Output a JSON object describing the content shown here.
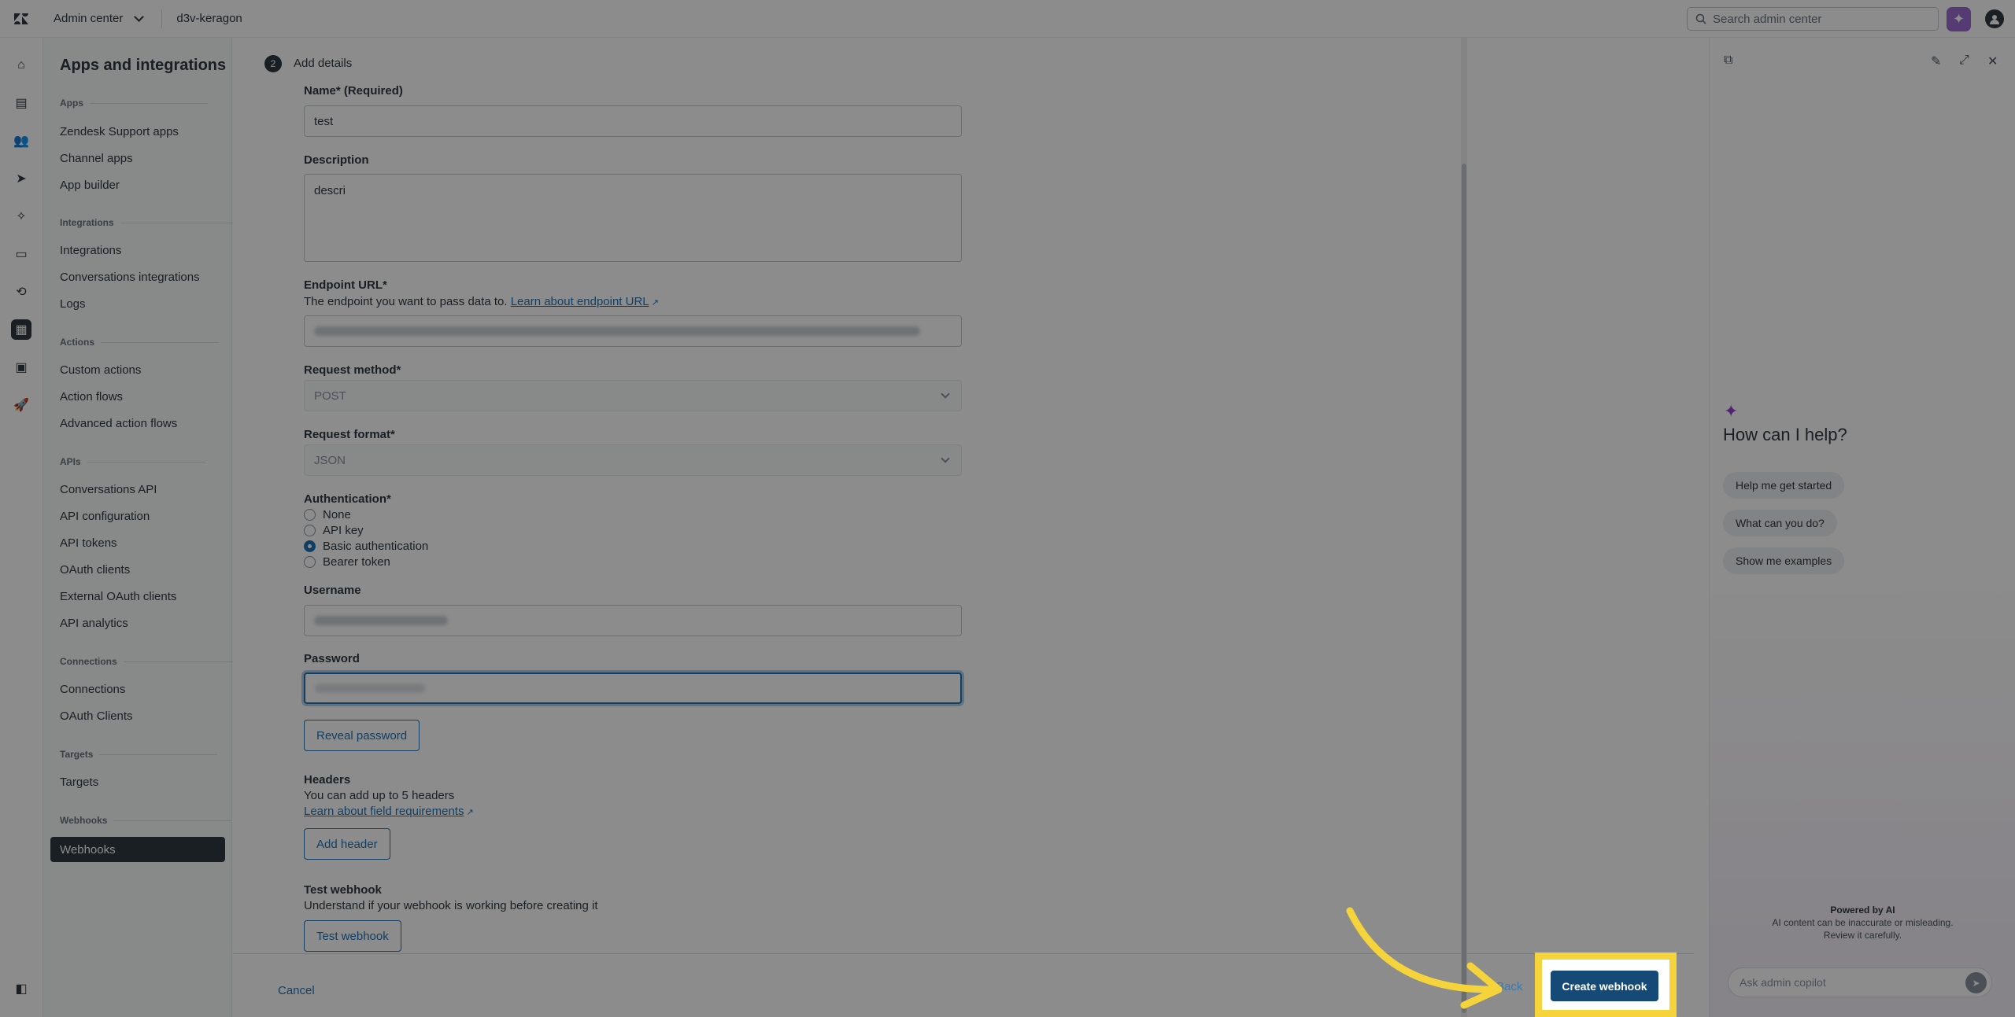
{
  "header": {
    "product": "Admin center",
    "account": "d3v-keragon",
    "search_placeholder": "Search admin center"
  },
  "sidebar": {
    "title": "Apps and integrations",
    "sections": {
      "apps": "Apps",
      "integrations": "Integrations",
      "actions": "Actions",
      "apis": "APIs",
      "connections": "Connections",
      "targets": "Targets",
      "webhooks": "Webhooks"
    },
    "items": {
      "zendesk_support_apps": "Zendesk Support apps",
      "channel_apps": "Channel apps",
      "app_builder": "App builder",
      "integrations": "Integrations",
      "conversations_integrations": "Conversations integrations",
      "logs": "Logs",
      "custom_actions": "Custom actions",
      "action_flows": "Action flows",
      "advanced_action_flows": "Advanced action flows",
      "conversations_api": "Conversations API",
      "api_configuration": "API configuration",
      "api_tokens": "API tokens",
      "oauth_clients": "OAuth clients",
      "external_oauth_clients": "External OAuth clients",
      "api_analytics": "API analytics",
      "connections": "Connections",
      "oauth_clients_caps": "OAuth Clients",
      "targets": "Targets",
      "webhooks": "Webhooks"
    }
  },
  "form": {
    "step_number": "2",
    "step_title": "Add details",
    "name_label": "Name* (Required)",
    "name_value": "test",
    "description_label": "Description",
    "description_value": "descri",
    "endpoint_label": "Endpoint URL*",
    "endpoint_hint": "The endpoint you want to pass data to.",
    "endpoint_link": "Learn about endpoint URL",
    "method_label": "Request method*",
    "method_value": "POST",
    "format_label": "Request format*",
    "format_value": "JSON",
    "auth_label": "Authentication*",
    "auth_options": [
      "None",
      "API key",
      "Basic authentication",
      "Bearer token"
    ],
    "auth_selected": "Basic authentication",
    "username_label": "Username",
    "password_label": "Password",
    "reveal_password": "Reveal password",
    "headers_label": "Headers",
    "headers_hint": "You can add up to 5 headers",
    "headers_link": "Learn about field requirements",
    "add_header": "Add header",
    "test_label": "Test webhook",
    "test_hint": "Understand if your webhook is working before creating it",
    "test_button": "Test webhook"
  },
  "footer": {
    "cancel": "Cancel",
    "back": "Back",
    "create": "Create webhook"
  },
  "copilot": {
    "title": "How can I help?",
    "chips": [
      "Help me get started",
      "What can you do?",
      "Show me examples"
    ],
    "powered": "Powered by AI",
    "disclaimer_1": "AI content can be inaccurate or misleading.",
    "disclaimer_2": "Review it carefully.",
    "ask_placeholder": "Ask admin copilot"
  },
  "colors": {
    "accent": "#1f73b7",
    "primary_button": "#144a75",
    "highlight": "#f5d33a",
    "copilot": "#9b6bd1"
  }
}
